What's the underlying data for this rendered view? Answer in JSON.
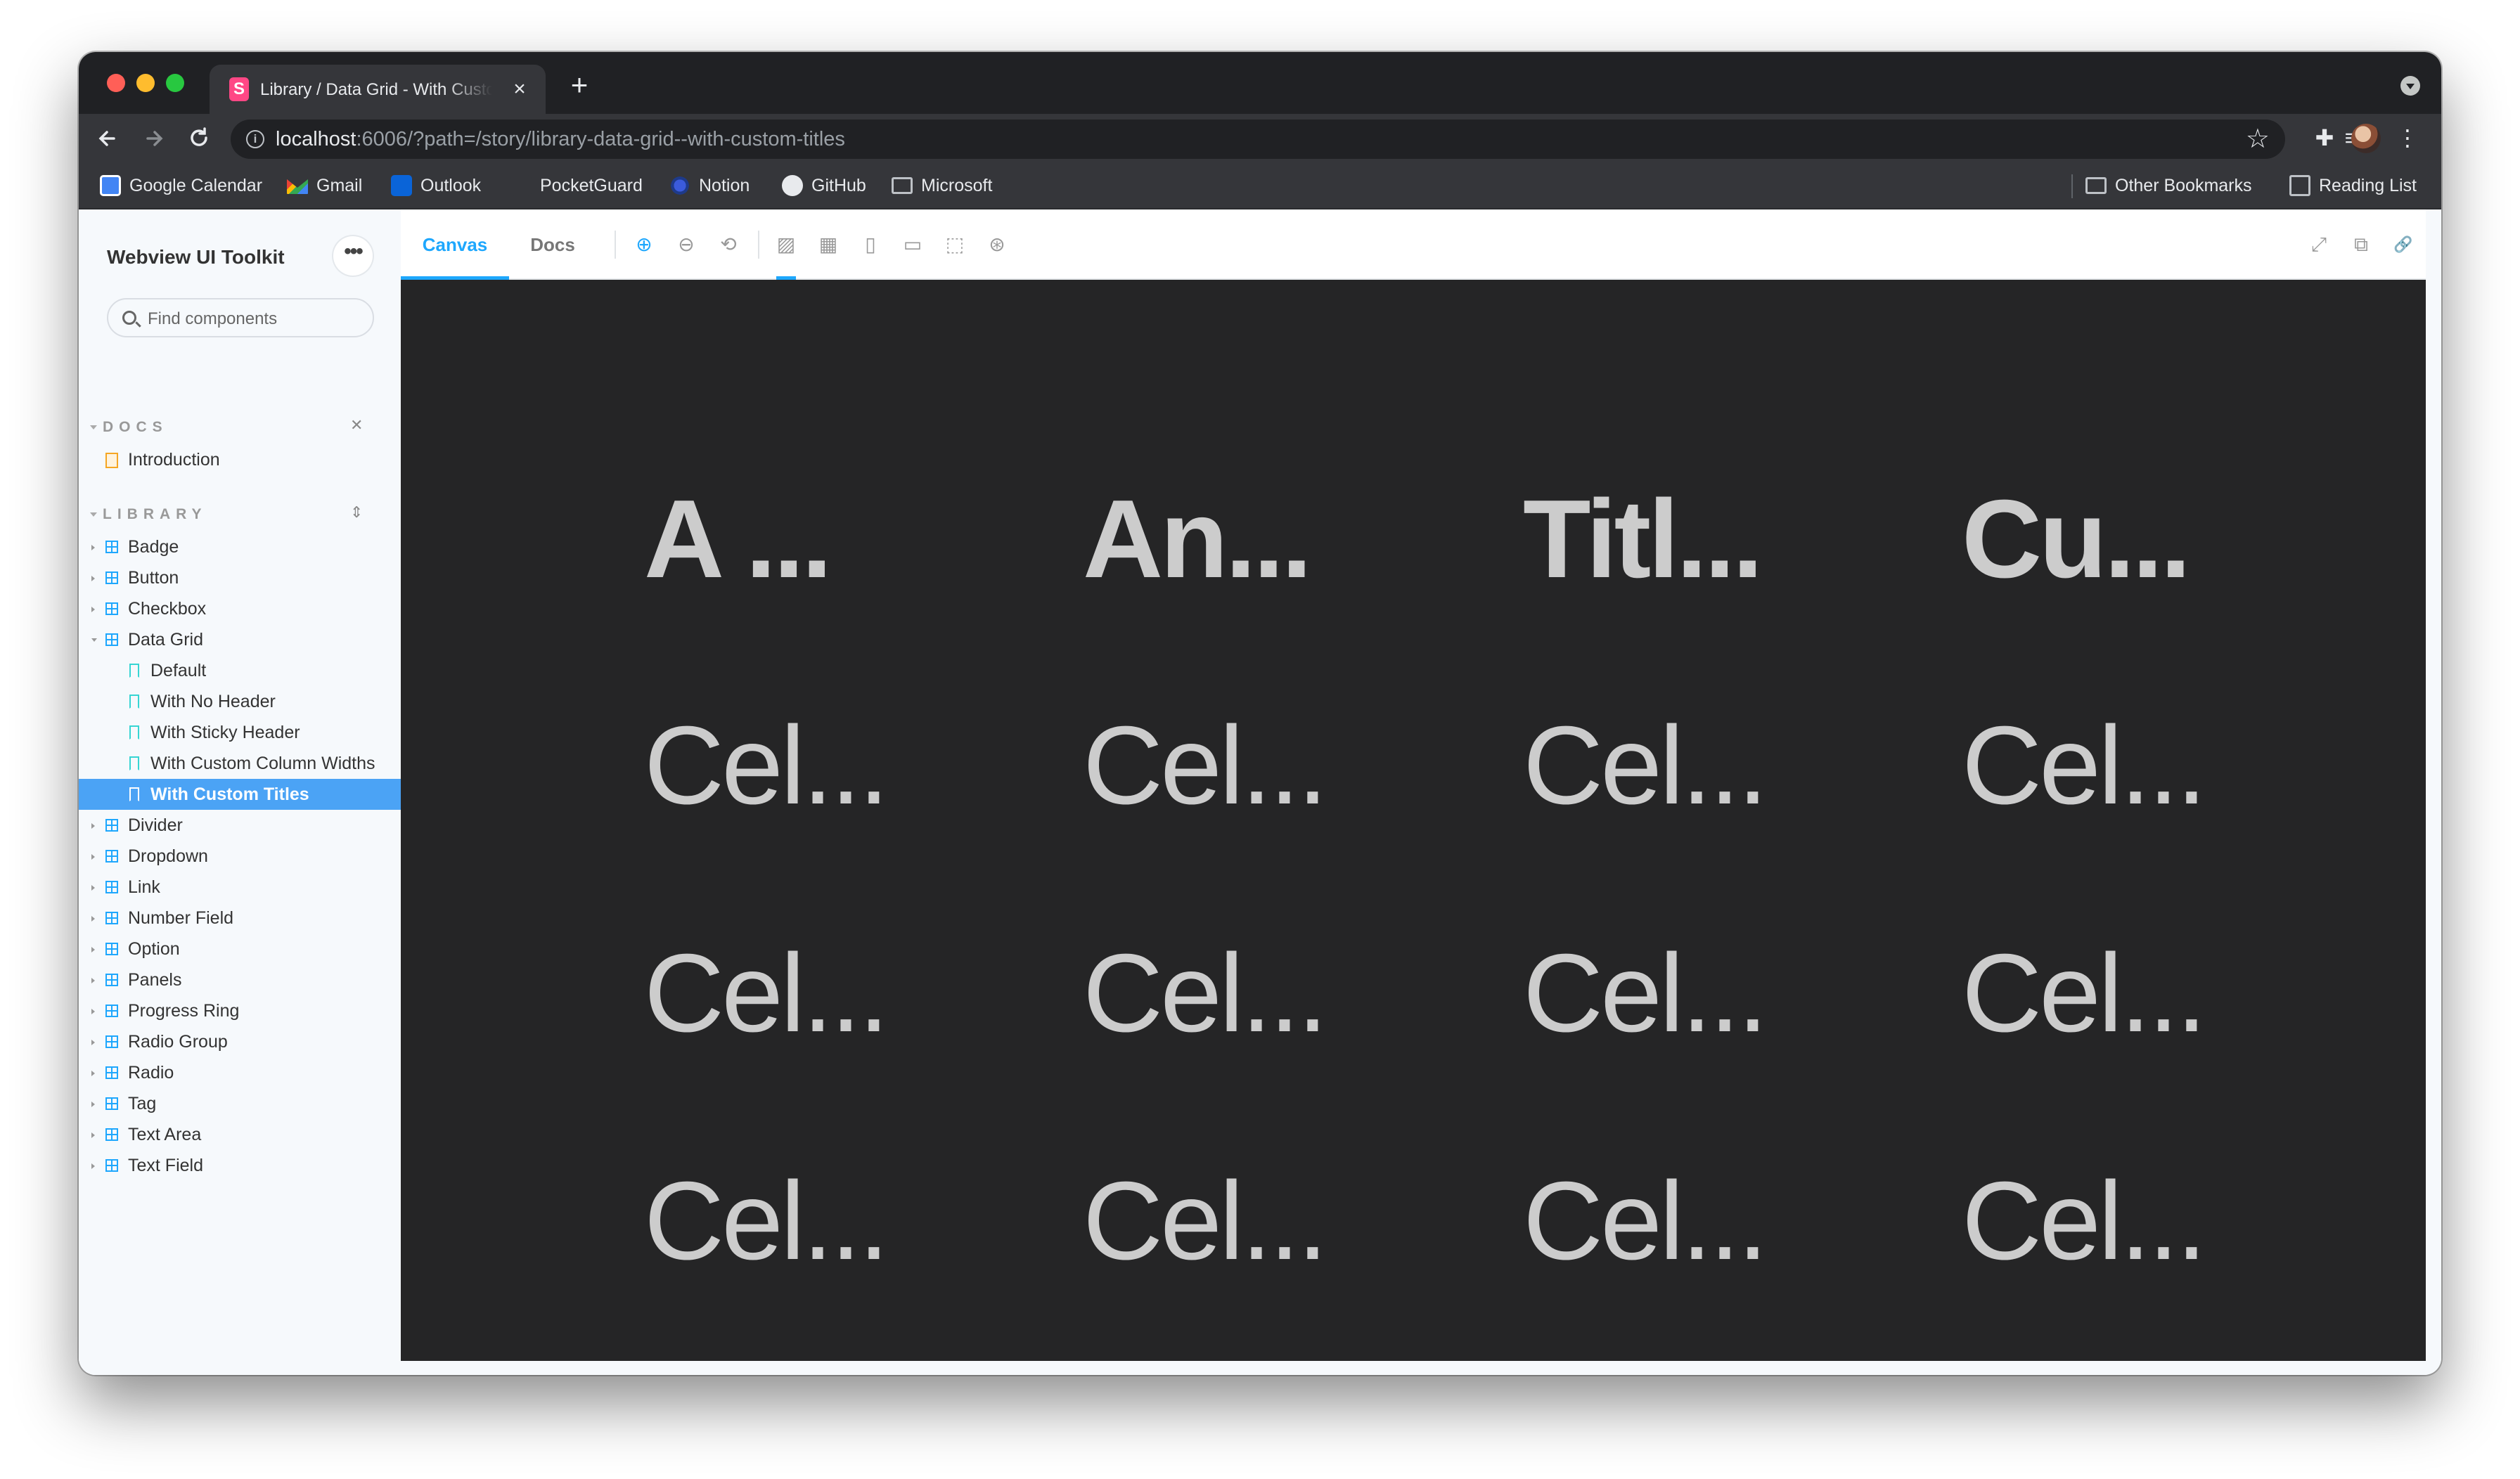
{
  "browser": {
    "tab_title": "Library / Data Grid - With Custom Titles",
    "tab_close": "×",
    "new_tab": "+",
    "url_host": "localhost",
    "url_rest": ":6006/?path=/story/library-data-grid--with-custom-titles",
    "info_glyph": "i",
    "nav": {
      "back": "←",
      "forward": "→",
      "reload": "↻"
    },
    "star": "☆",
    "extensions_glyph": "✚",
    "media_glyph": "≡",
    "menu_glyph": "⋮",
    "bookmarks": [
      {
        "label": "Google Calendar",
        "icon": "google-calendar-icon"
      },
      {
        "label": "Gmail",
        "icon": "gmail-icon"
      },
      {
        "label": "Outlook",
        "icon": "outlook-icon"
      },
      {
        "label": "PocketGuard",
        "icon": "pocketguard-icon"
      },
      {
        "label": "Notion",
        "icon": "notion-icon"
      },
      {
        "label": "GitHub",
        "icon": "github-icon"
      },
      {
        "label": "Microsoft",
        "icon": "folder-icon"
      }
    ],
    "other_bookmarks": "Other Bookmarks",
    "reading_list": "Reading List"
  },
  "storybook": {
    "brand": "Webview UI Toolkit",
    "more_glyph": "•••",
    "search_placeholder": "Find components",
    "docs_section": "DOCS",
    "library_section": "LIBRARY",
    "collapse_glyph": "✕",
    "expand_glyph": "⇕",
    "docs_items": [
      "Introduction"
    ],
    "library_items": [
      {
        "label": "Badge"
      },
      {
        "label": "Button"
      },
      {
        "label": "Checkbox"
      },
      {
        "label": "Data Grid",
        "expanded": true
      },
      {
        "label": "Default",
        "story": true
      },
      {
        "label": "With No Header",
        "story": true
      },
      {
        "label": "With Sticky Header",
        "story": true
      },
      {
        "label": "With Custom Column Widths",
        "story": true
      },
      {
        "label": "With Custom Titles",
        "story": true,
        "selected": true
      },
      {
        "label": "Divider"
      },
      {
        "label": "Dropdown"
      },
      {
        "label": "Link"
      },
      {
        "label": "Number Field"
      },
      {
        "label": "Option"
      },
      {
        "label": "Panels"
      },
      {
        "label": "Progress Ring"
      },
      {
        "label": "Radio Group"
      },
      {
        "label": "Radio"
      },
      {
        "label": "Tag"
      },
      {
        "label": "Text Area"
      },
      {
        "label": "Text Field"
      }
    ],
    "tabs": {
      "canvas": "Canvas",
      "docs": "Docs"
    },
    "toolbar_icons": {
      "zoom_in": "⊕",
      "zoom_out": "⊖",
      "zoom_reset": "⟲",
      "background": "▨",
      "grid": "▦",
      "viewport": "▯",
      "measure": "▭",
      "outline": "⬚",
      "accessibility": "⊛",
      "fullscreen": "⤢",
      "new_tab": "⧉",
      "copy_link": "🔗"
    },
    "grid": {
      "headers": [
        "A ...",
        "An...",
        "Titl...",
        "Cu..."
      ],
      "rows": [
        [
          "Cel...",
          "Cel...",
          "Cel...",
          "Cel..."
        ],
        [
          "Cel...",
          "Cel...",
          "Cel...",
          "Cel..."
        ],
        [
          "Cel...",
          "Cel...",
          "Cel...",
          "Cel..."
        ]
      ]
    },
    "colors": {
      "accent": "#1ea7fd",
      "selected": "#4ba3f5",
      "canvas_bg": "#252526",
      "cell_text": "#cccccc"
    }
  }
}
